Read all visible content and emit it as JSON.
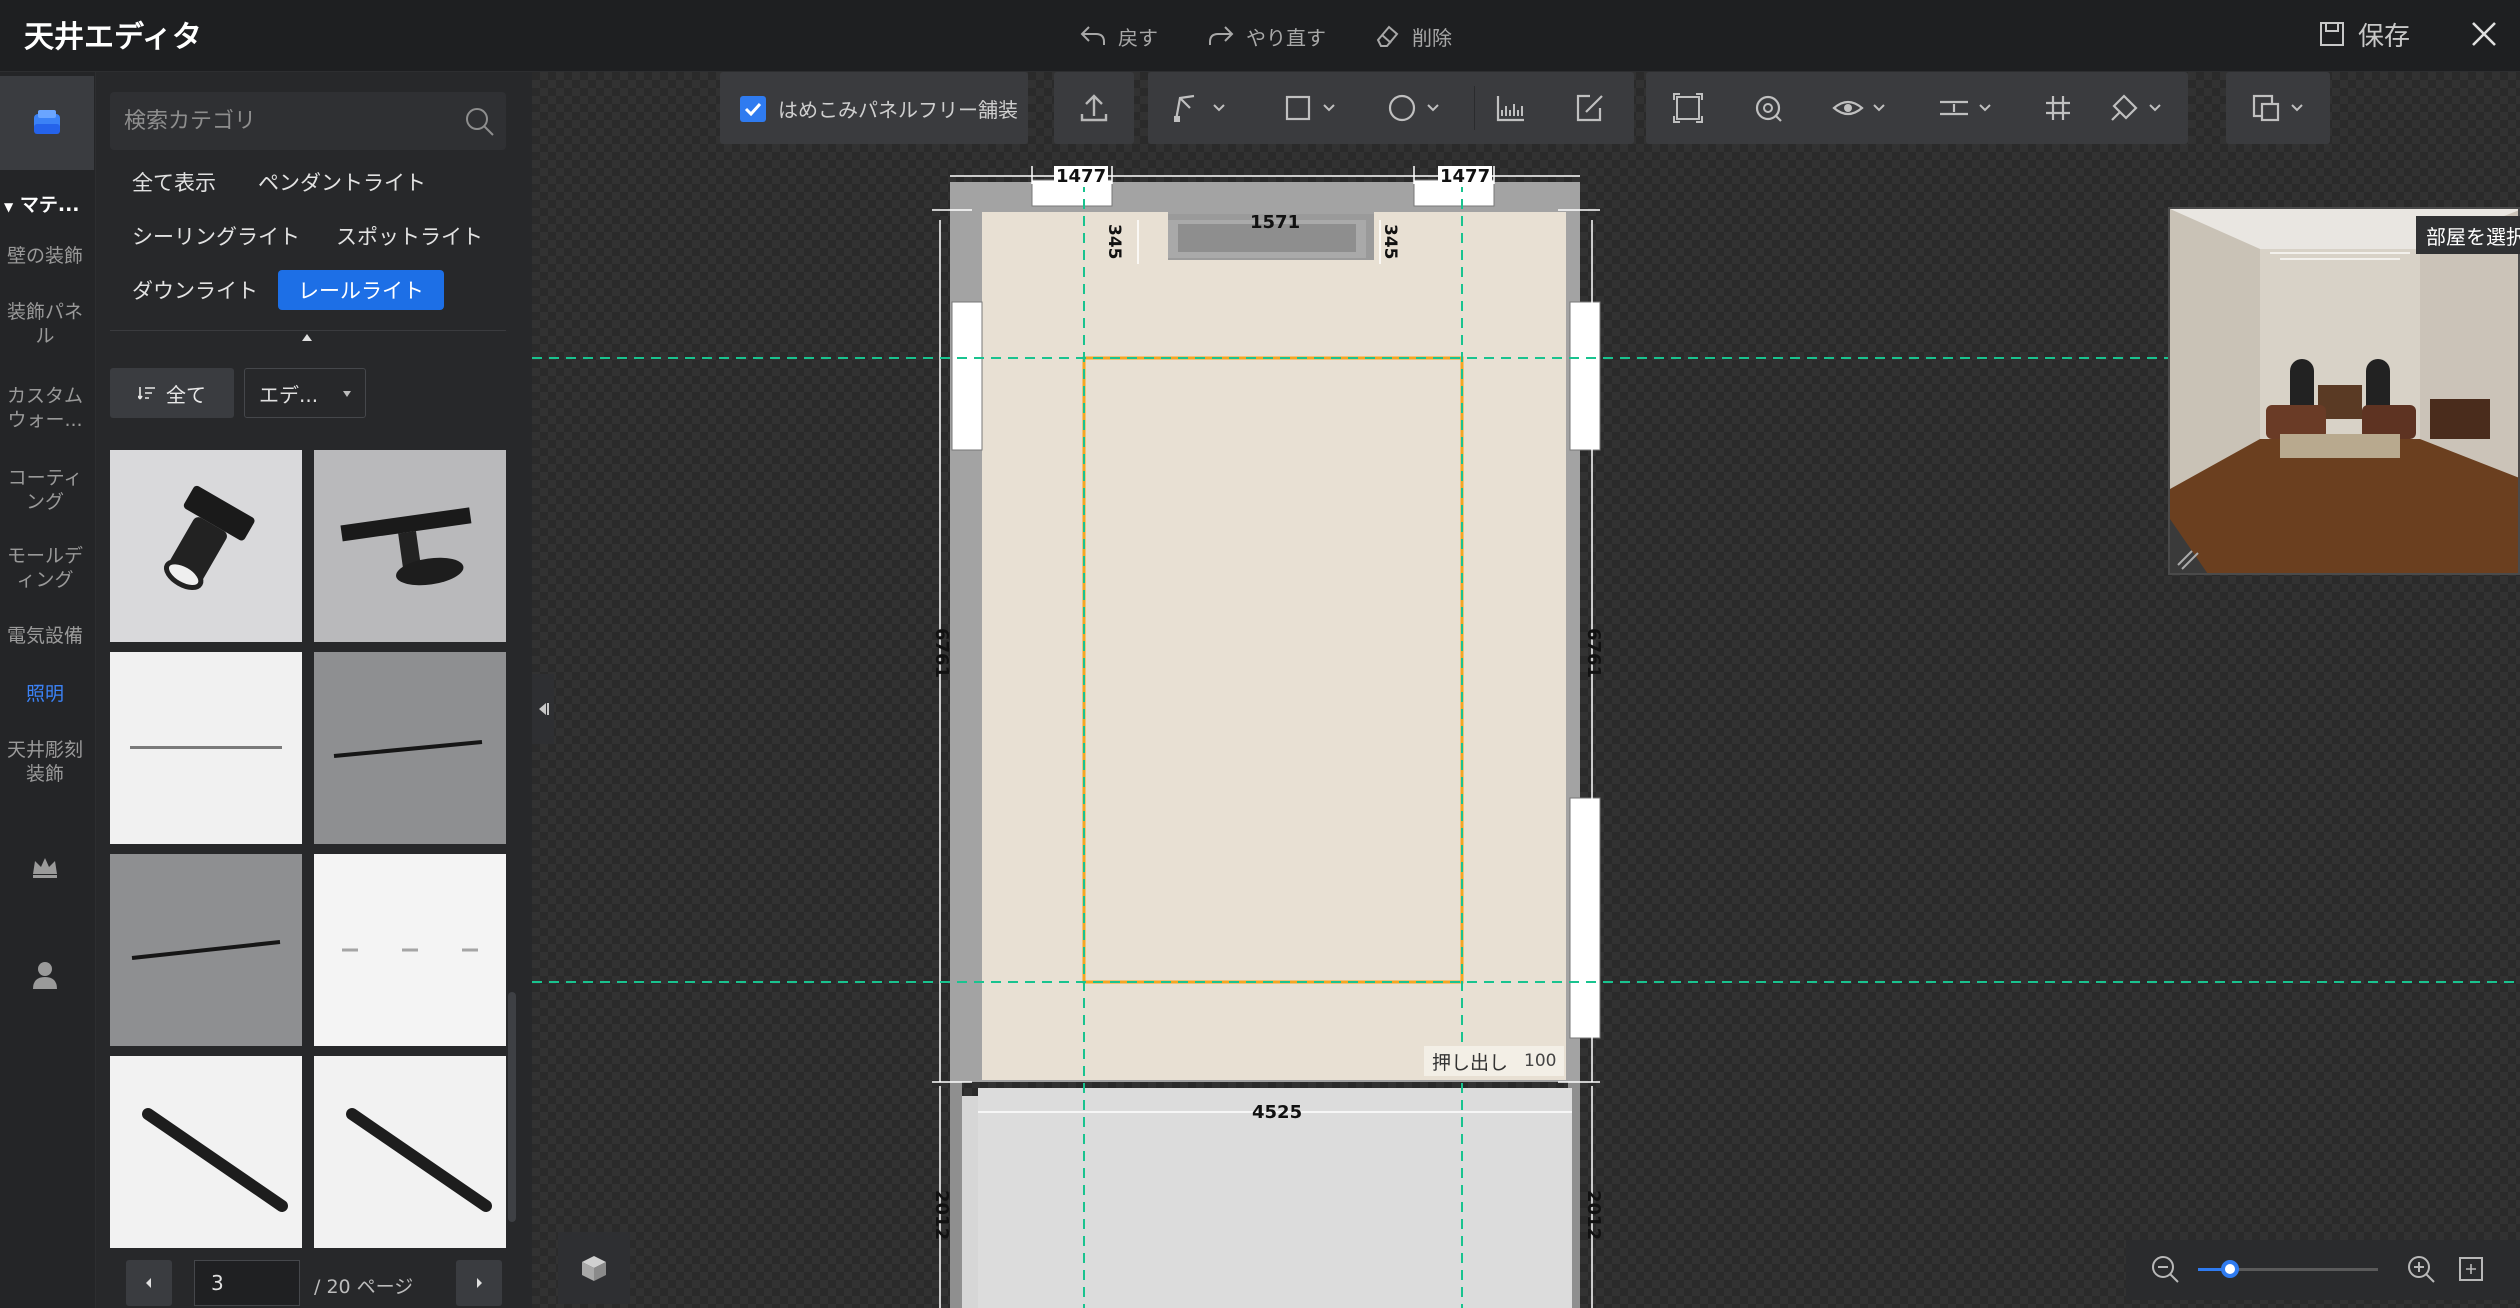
{
  "app": {
    "title": "天井エディタ"
  },
  "header": {
    "undo_label": "戻す",
    "redo_label": "やり直す",
    "delete_label": "削除",
    "save_label": "保存"
  },
  "rail": {
    "section_label": "マテ...",
    "items": [
      {
        "label": "壁の装飾"
      },
      {
        "label": "装飾パネル"
      },
      {
        "label": "カスタムウォー..."
      },
      {
        "label": "コーティング"
      },
      {
        "label": "モールディング"
      },
      {
        "label": "電気設備"
      },
      {
        "label": "照明"
      },
      {
        "label": "天井彫刻装飾"
      }
    ]
  },
  "panel": {
    "search_placeholder": "検索カテゴリ",
    "categories": [
      {
        "label": "全て表示"
      },
      {
        "label": "ペンダントライト"
      },
      {
        "label": "シーリングライト"
      },
      {
        "label": "スポットライト"
      },
      {
        "label": "ダウンライト"
      },
      {
        "label": "レールライト"
      }
    ],
    "active_category": "レールライト",
    "sort_label": "全て",
    "filter_label": "エデ...",
    "pagination": {
      "current": "3",
      "total_label": "/ 20 ページ"
    }
  },
  "toolbar": {
    "seamless_label": "はめこみパネルフリー舗装",
    "seamless_checked": true
  },
  "plan": {
    "dims": {
      "top_left": "1477",
      "top_right": "1477",
      "notch_width": "1571",
      "notch_left_depth": "345",
      "notch_right_depth": "345",
      "left_height": "6761",
      "right_height": "6761",
      "bottom_width": "4525",
      "lower_left": "2012",
      "lower_right": "2012"
    },
    "extrude_label": "押し出し",
    "extrude_value": "100"
  },
  "preview": {
    "label": "部屋を選択"
  },
  "zoom": {
    "level": 0.18
  },
  "colors": {
    "accent": "#1d6fe6",
    "guide": "#19c38f",
    "selection": "#f5a623",
    "ceiling": "#e8dfd2"
  }
}
